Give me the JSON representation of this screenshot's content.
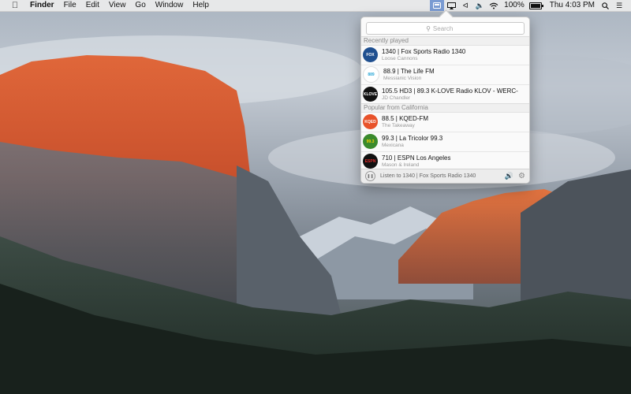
{
  "menubar": {
    "apple_icon": "apple-icon",
    "app_name": "Finder",
    "menus": [
      "File",
      "Edit",
      "View",
      "Go",
      "Window",
      "Help"
    ],
    "battery_percent": "100%",
    "battery_level": 1.0,
    "clock": "Thu 4:03 PM",
    "status_icons": [
      "radio-app-icon",
      "airplay-icon",
      "bluetooth-icon",
      "volume-icon",
      "wifi-icon",
      "battery-icon",
      "search-icon",
      "notification-center-icon"
    ]
  },
  "popover": {
    "search": {
      "placeholder": "Search",
      "value": ""
    },
    "recent_header": "Recently played",
    "recent": [
      {
        "name": "1340 | Fox Sports Radio 1340",
        "sub": "Loose Cannons",
        "logo_text": "FOX",
        "logo_color": "#1f4f8f"
      },
      {
        "name": "88.9 | The Life FM",
        "sub": "Messianic Vision",
        "logo_text": "889",
        "logo_color": "#ffffff"
      },
      {
        "name": "105.5 HD3 | 89.3 K-LOVE Radio KLOV - WERC-",
        "sub": "JD Chandler",
        "logo_text": "KLOVE",
        "logo_color": "#111111"
      }
    ],
    "popular_header": "Popular from California",
    "popular": [
      {
        "name": "88.5 | KQED-FM",
        "sub": "The Takeaway",
        "logo_text": "KQED",
        "logo_color": "#e8522a"
      },
      {
        "name": "99.3 | La Tricolor 99.3",
        "sub": "Mexicana",
        "logo_text": "99.3",
        "logo_color": "#3a8a2c"
      },
      {
        "name": "710 | ESPN Los Angeles",
        "sub": "Mason & Ireland",
        "logo_text": "ESPN",
        "logo_color": "#111111"
      }
    ],
    "footer": {
      "now_playing": "Listen to 1340 | Fox Sports Radio 1340"
    }
  }
}
